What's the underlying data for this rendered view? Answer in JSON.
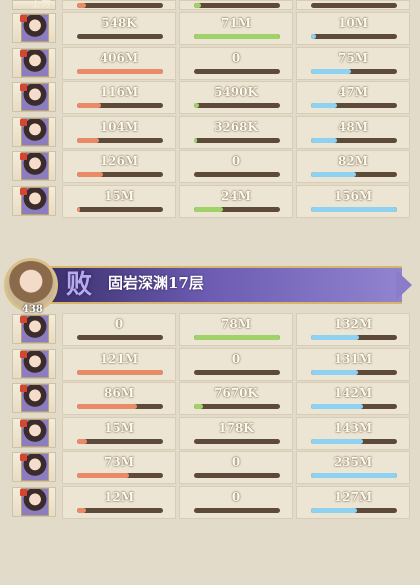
{
  "top_fragment": {
    "label": "上方",
    "fills": [
      0.1,
      0.08,
      0.0
    ]
  },
  "group_1": {
    "rows": [
      {
        "v1": "548K",
        "p1": 0.0,
        "v2": "71M",
        "p2": 1.0,
        "v3": "10M",
        "p3": 0.06
      },
      {
        "v1": "406M",
        "p1": 1.0,
        "v2": "0",
        "p2": 0.0,
        "v3": "75M",
        "p3": 0.46
      },
      {
        "v1": "116M",
        "p1": 0.28,
        "v2": "5490K",
        "p2": 0.06,
        "v3": "47M",
        "p3": 0.3
      },
      {
        "v1": "104M",
        "p1": 0.25,
        "v2": "3268K",
        "p2": 0.04,
        "v3": "48M",
        "p3": 0.3
      },
      {
        "v1": "126M",
        "p1": 0.3,
        "v2": "0",
        "p2": 0.0,
        "v3": "82M",
        "p3": 0.52
      },
      {
        "v1": "15M",
        "p1": 0.04,
        "v2": "24M",
        "p2": 0.34,
        "v3": "156M",
        "p3": 1.0
      }
    ]
  },
  "banner": {
    "level": "438",
    "result_char": "败",
    "stage_name": "固岩深渊17层"
  },
  "group_2": {
    "rows": [
      {
        "v1": "0",
        "p1": 0.0,
        "v2": "78M",
        "p2": 1.0,
        "v3": "132M",
        "p3": 0.56
      },
      {
        "v1": "121M",
        "p1": 1.0,
        "v2": "0",
        "p2": 0.0,
        "v3": "131M",
        "p3": 0.55
      },
      {
        "v1": "86M",
        "p1": 0.7,
        "v2": "7670K",
        "p2": 0.1,
        "v3": "142M",
        "p3": 0.6
      },
      {
        "v1": "15M",
        "p1": 0.12,
        "v2": "178K",
        "p2": 0.0,
        "v3": "143M",
        "p3": 0.6
      },
      {
        "v1": "73M",
        "p1": 0.6,
        "v2": "0",
        "p2": 0.0,
        "v3": "235M",
        "p3": 1.0
      },
      {
        "v1": "12M",
        "p1": 0.1,
        "v2": "0",
        "p2": 0.0,
        "v3": "127M",
        "p3": 0.54
      }
    ]
  },
  "colors": {
    "damage_bar": "#ea8b68",
    "heal_bar": "#9fd268",
    "taken_bar": "#8fd1f0",
    "banner_purple": "#6c5bb2"
  },
  "icons": {
    "hero_portrait": "hero-portrait-icon",
    "rank_badge": "rank-star-icon"
  }
}
